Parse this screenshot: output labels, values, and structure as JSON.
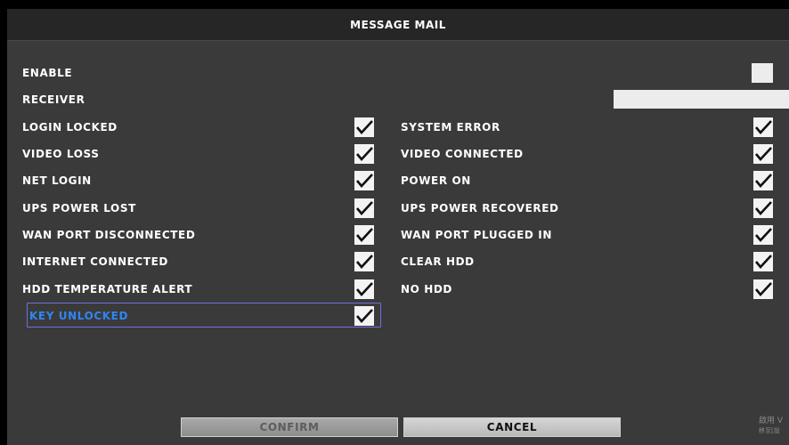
{
  "dialog": {
    "title": "MESSAGE MAIL"
  },
  "settings": {
    "enable_label": "ENABLE",
    "enable_checked": false,
    "receiver_label": "RECEIVER",
    "receiver_value": ""
  },
  "events": {
    "left": [
      {
        "label": "LOGIN LOCKED",
        "checked": true
      },
      {
        "label": "VIDEO LOSS",
        "checked": true
      },
      {
        "label": "NET LOGIN",
        "checked": true
      },
      {
        "label": "UPS POWER LOST",
        "checked": true
      },
      {
        "label": "WAN PORT DISCONNECTED",
        "checked": true
      },
      {
        "label": "INTERNET CONNECTED",
        "checked": true
      },
      {
        "label": "HDD TEMPERATURE ALERT",
        "checked": true
      },
      {
        "label": "KEY UNLOCKED",
        "checked": true
      }
    ],
    "right": [
      {
        "label": "SYSTEM ERROR",
        "checked": true
      },
      {
        "label": "VIDEO CONNECTED",
        "checked": true
      },
      {
        "label": "POWER ON",
        "checked": true
      },
      {
        "label": "UPS POWER RECOVERED",
        "checked": true
      },
      {
        "label": "WAN PORT PLUGGED IN",
        "checked": true
      },
      {
        "label": "CLEAR HDD",
        "checked": true
      },
      {
        "label": "NO HDD",
        "checked": true
      }
    ]
  },
  "buttons": {
    "confirm": "CONFIRM",
    "cancel": "CANCEL"
  },
  "watermark": {
    "line1": "啟用 V",
    "line2": "移至[設"
  },
  "colors": {
    "dialog_bg": "#3a3a3a",
    "titlebar_bg": "#262626",
    "focus_text": "#2f86f5",
    "focus_border": "#6f6fe0"
  }
}
